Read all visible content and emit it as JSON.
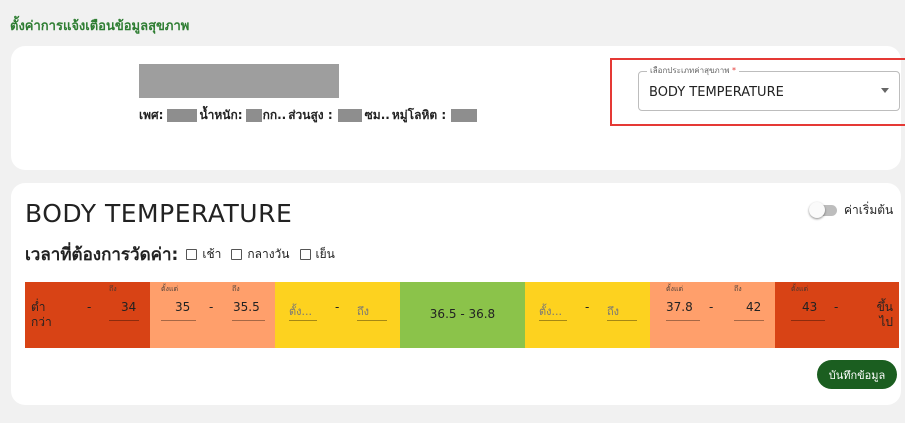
{
  "page": {
    "title": "ตั้งค่าการแจ้งเตือนข้อมูลสุขภาพ"
  },
  "profile": {
    "gender_label": "เพศ:",
    "weight_label": "น้ำหนัก:",
    "weight_unit": "กก..",
    "height_label": "ส่วนสูง :",
    "height_unit": "ซม..",
    "blood_label": "หมู่โลหิต :"
  },
  "health_type_select": {
    "label": "เลือกประเภทค่าสุขภาพ",
    "required_mark": "*",
    "value": "BODY TEMPERATURE"
  },
  "section": {
    "title": "BODY TEMPERATURE",
    "toggle_label": "ค่าเริ่มต้น",
    "toggle_on": false
  },
  "time": {
    "label": "เวลาที่ต้องการวัดค่า:",
    "options": [
      {
        "label": "เช้า",
        "checked": false
      },
      {
        "label": "กลางวัน",
        "checked": false
      },
      {
        "label": "เย็น",
        "checked": false
      }
    ]
  },
  "range_bar": {
    "from_label": "ตั้งแต่",
    "to_label": "ถึง",
    "from_placeholder": "ตั้ง...",
    "to_placeholder": "ถึง",
    "dash": "-",
    "colors": {
      "red": "#d84315",
      "orange": "#ff9f6b",
      "yellow": "#fdd21f",
      "green": "#8bc34a"
    },
    "segments": [
      {
        "color": "red",
        "from": "ต่ำกว่า",
        "to": "34"
      },
      {
        "color": "orange",
        "from": "35",
        "to": "35.5"
      },
      {
        "color": "yellow",
        "from": "",
        "to": ""
      },
      {
        "color": "green",
        "center": "36.5 - 36.8"
      },
      {
        "color": "yellow",
        "from": "",
        "to": ""
      },
      {
        "color": "orange",
        "from": "37.8",
        "to": "42"
      },
      {
        "color": "red",
        "from": "43",
        "to": "ขึ้นไป"
      }
    ]
  },
  "save_button": {
    "label": "บันทึกข้อมูล",
    "color": "#1b5e20"
  }
}
